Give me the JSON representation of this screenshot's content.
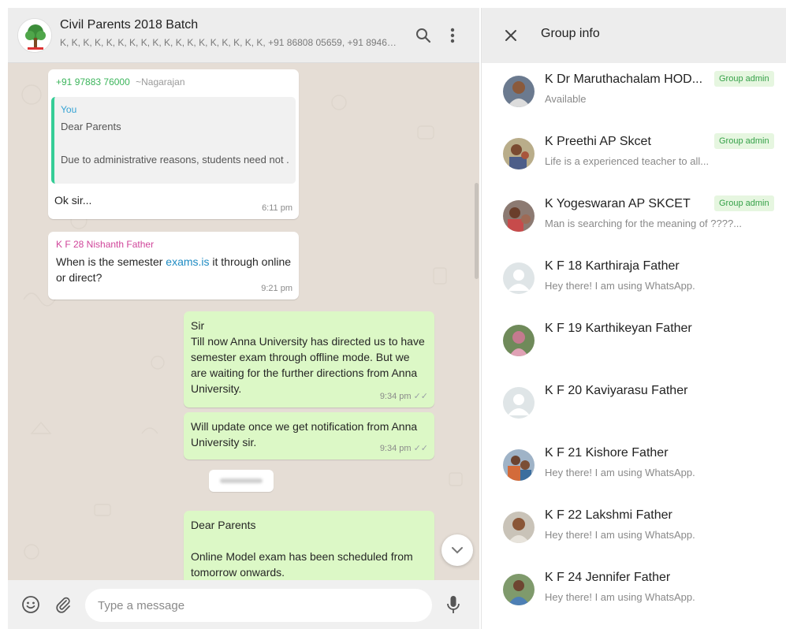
{
  "chat": {
    "group_name": "Civil Parents  2018 Batch",
    "participants_summary": "K, K, K, K, K, K, K, K, K, K, K, K, K, K, K, K, K, K, +91 86808 05659, +91 89460 825...",
    "icons": {
      "search": "search-icon",
      "menu": "more-vert-icon"
    },
    "messages": [
      {
        "sender": "+91 97883 76000",
        "sender_alias": "~Nagarajan",
        "quote_author": "You",
        "quote_line1": "Dear Parents",
        "quote_line2": "Due to administrative reasons, students need not ...",
        "text": "Ok sir...",
        "time": "6:11 pm"
      },
      {
        "sender": "K F 28 Nishanth Father",
        "text_before": "When  is the semester ",
        "link": "exams.is",
        "text_after": " it through online or direct?",
        "time": "9:21 pm"
      },
      {
        "text_line1": "Sir",
        "text_line2": "Till now Anna University has directed us to have semester exam through offline mode. But we are waiting for the further directions from Anna University.",
        "time": "9:34 pm",
        "ticks": "✓✓"
      },
      {
        "text": "Will update once we get notification from Anna University sir.",
        "time": "9:34 pm",
        "ticks": "✓✓"
      },
      {
        "text_line1": "Dear Parents",
        "text_line2": "Online Model exam has been scheduled from tomorrow onwards."
      }
    ],
    "composer": {
      "placeholder": "Type a message",
      "icons": {
        "emoji": "emoji-icon",
        "attach": "attach-icon",
        "mic": "mic-icon"
      }
    }
  },
  "info_panel": {
    "title": "Group info",
    "close_icon": "close-icon",
    "admin_label": "Group admin",
    "members": [
      {
        "name": "K Dr Maruthachalam HOD...",
        "status": "Available",
        "admin": true
      },
      {
        "name": "K Preethi AP Skcet",
        "status": "Life is a experienced teacher to all...",
        "admin": true
      },
      {
        "name": "K Yogeswaran AP SKCET",
        "status": "Man is searching for the meaning of ????...",
        "admin": true
      },
      {
        "name": "K F 18 Karthiraja Father",
        "status": "Hey there! I am using WhatsApp.",
        "admin": false
      },
      {
        "name": "K F 19 Karthikeyan Father",
        "status": "",
        "admin": false
      },
      {
        "name": "K F 20 Kaviyarasu Father",
        "status": "",
        "admin": false
      },
      {
        "name": "K F 21 Kishore Father",
        "status": "Hey there! I am using WhatsApp.",
        "admin": false
      },
      {
        "name": "K F 22 Lakshmi Father",
        "status": "Hey there! I am using WhatsApp.",
        "admin": false
      },
      {
        "name": "K F 24 Jennifer Father",
        "status": "Hey there! I am using WhatsApp.",
        "admin": false
      }
    ]
  },
  "colors": {
    "outgoing_bubble": "#dcf8c6",
    "incoming_bubble": "#ffffff",
    "chat_background": "#e5ddd5",
    "admin_badge": "#36a149",
    "sender_1": "#3cb55b",
    "sender_2": "#d0459a"
  }
}
